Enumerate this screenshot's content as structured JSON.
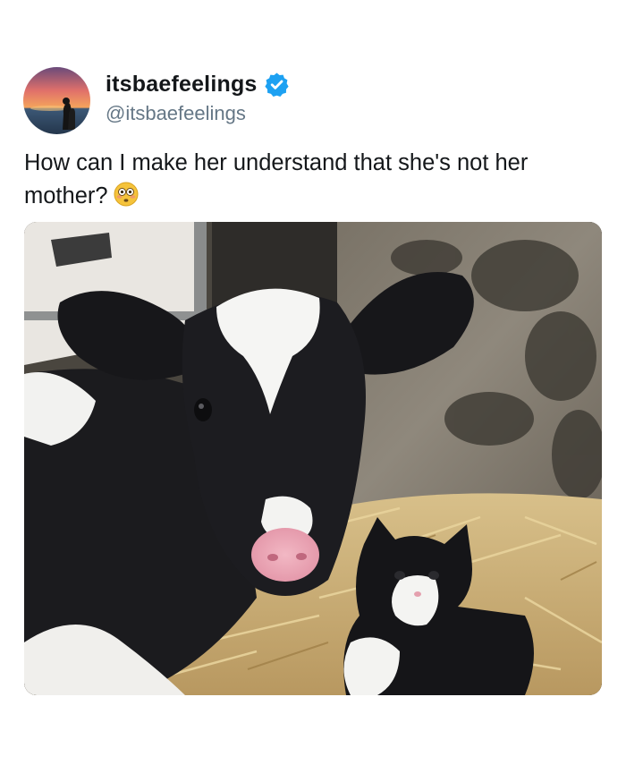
{
  "tweet": {
    "display_name": "itsbaefeelings",
    "handle": "@itsbaefeelings",
    "text": "How can I make her understand that she's not her mother?",
    "emoji": "flushed-face-emoji",
    "verified": true,
    "avatar": "sunset-couple-avatar",
    "photo": "calf-and-kitten-on-straw-photo"
  },
  "colors": {
    "text": "#14171a",
    "secondary": "#657786",
    "verified_blue": "#1da1f2"
  }
}
